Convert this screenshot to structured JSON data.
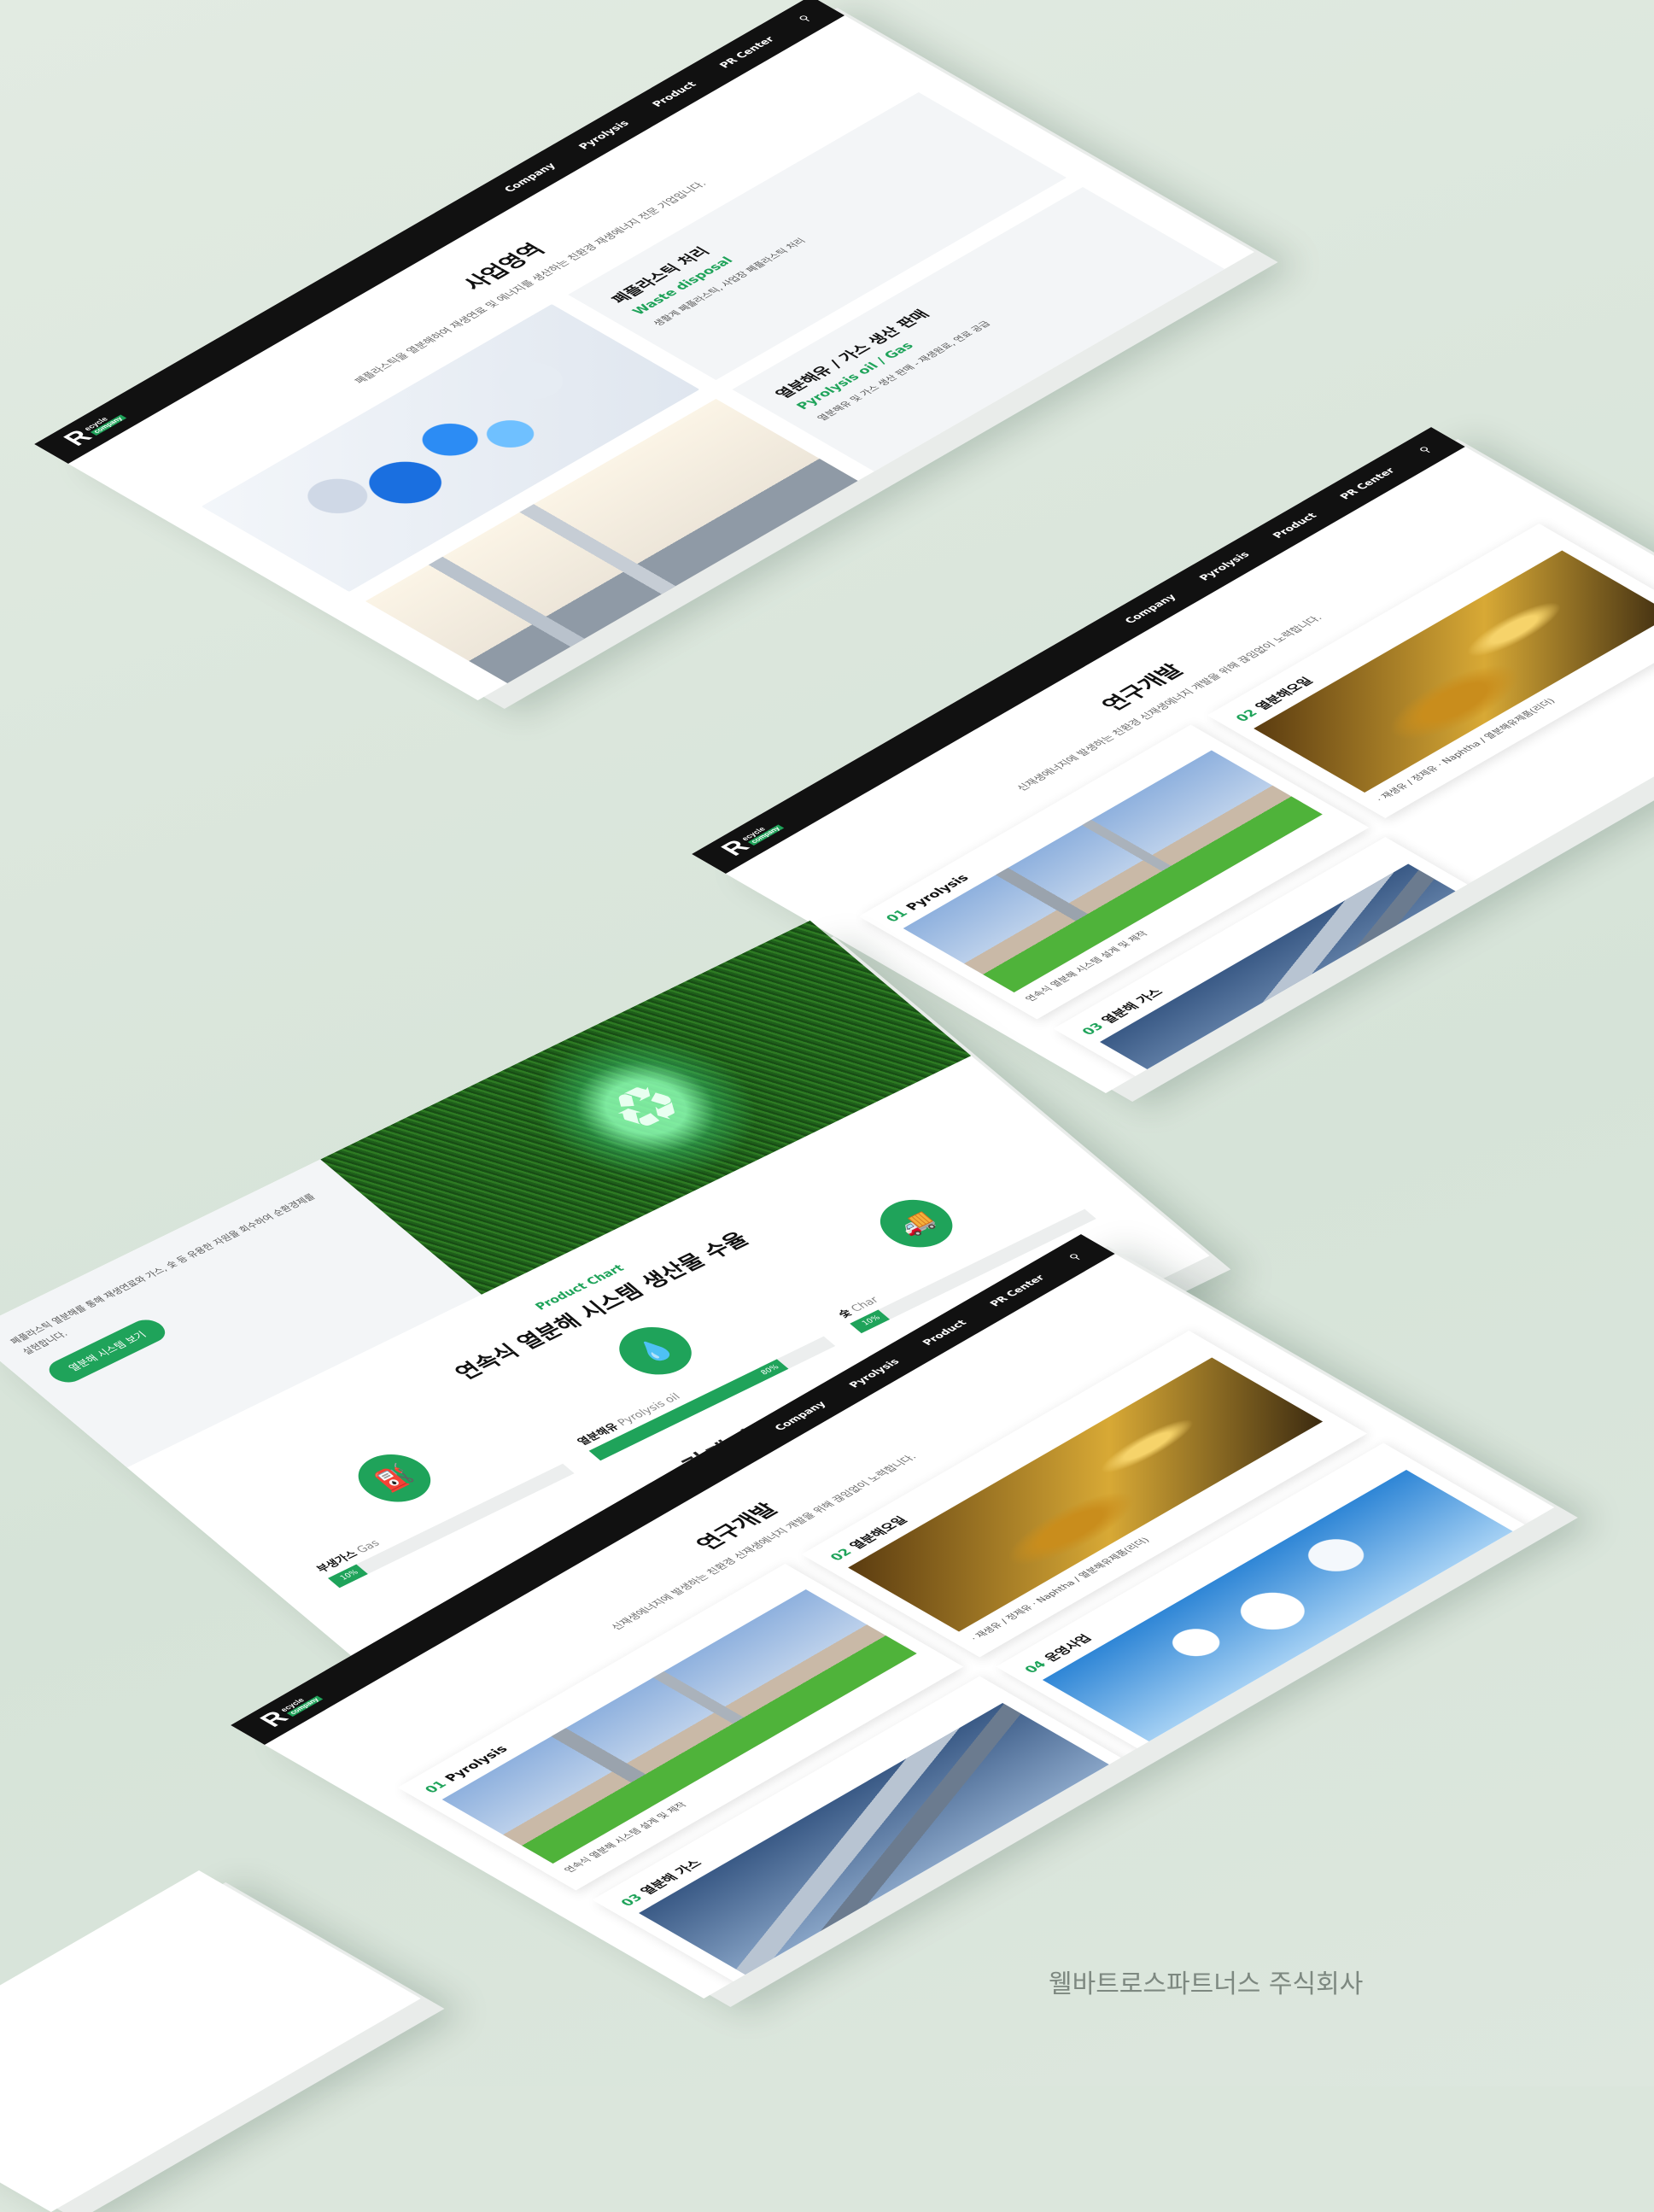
{
  "brand": {
    "logo_letter": "R",
    "logo_top": "ecycle",
    "logo_bottom": "company"
  },
  "nav": [
    "Company",
    "Pyrolysis",
    "Product",
    "PR Center"
  ],
  "search_icon": "search-icon",
  "business": {
    "title": "사업영역",
    "desc": "폐플라스틱을 열분해하여 재생연료 및 에너지를 생산하는 친환경 재생에너지 전문 기업입니다.",
    "cards": [
      {
        "title": "폐플라스틱 처리",
        "en": "Waste disposal",
        "desc": "생활계 폐플라스틱, 사업장 폐플라스틱 처리"
      },
      {
        "title": "열분해유 / 가스 생산 판매",
        "en": "Pyrolysis oil / Gas",
        "desc": "열분해유 및 가스 생산 판매 - 재생원료, 연료 공급"
      }
    ]
  },
  "research": {
    "title": "연구개발",
    "desc": "신재생에너지에 발생하는 친환경 신재생에너지 개발을 위해 끊임없이 노력합니다.",
    "cards": [
      {
        "num": "01",
        "title": "Pyrolysis",
        "caption": "연속식 열분해 시스템 설계 및 제작"
      },
      {
        "num": "02",
        "title": "열분해오일",
        "caption": "· 재생유 / 정제유  · Naphtha / 열분해유제품(리더)"
      },
      {
        "num": "03",
        "title": "열분해 가스",
        "caption": ""
      },
      {
        "num": "04",
        "title": "운영사업",
        "caption": ""
      }
    ]
  },
  "product_chart": {
    "sub": "Product Chart",
    "title": "연속식 열분해 시스템 생산물 수율",
    "side_text": "폐플라스틱 열분해를 통해 재생연료와 가스, 숯 등 유용한 자원을 회수하여 순환경제를 실현합니다.",
    "button": "열분해 시스템 보기",
    "overlay": "기계가 이 악속",
    "products": [
      {
        "label": "부생가스",
        "en": "Gas",
        "icon": "gas-pump-icon",
        "glyph": "⛽",
        "percent": 10,
        "bar_text": "10%"
      },
      {
        "label": "열분해유",
        "en": "Pyrolysis oil",
        "icon": "oil-drop-icon",
        "glyph": "💧",
        "percent": 80,
        "bar_text": "80%"
      },
      {
        "label": "숯",
        "en": "Char",
        "icon": "truck-icon",
        "glyph": "🚚",
        "percent": 10,
        "bar_text": "10%"
      }
    ]
  },
  "footer": {
    "company": "웰바트로스파트너스 주식회사"
  }
}
